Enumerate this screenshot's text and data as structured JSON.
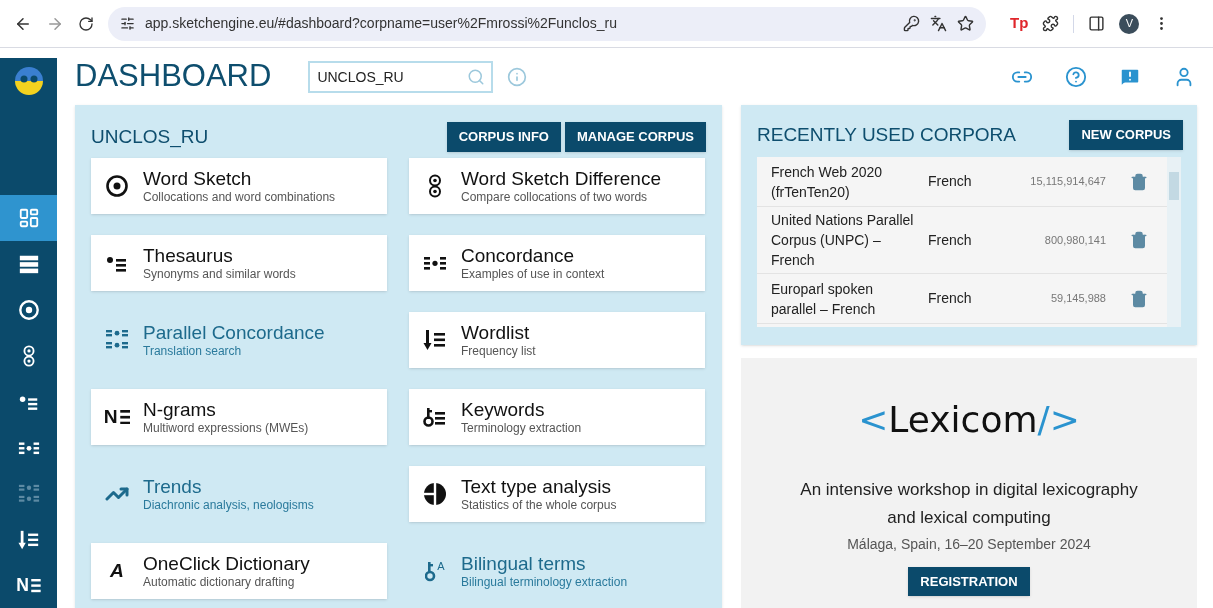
{
  "browser": {
    "url": "app.sketchengine.eu/#dashboard?corpname=user%2Fmrossi%2Funclos_ru",
    "extension_label": "Tp",
    "avatar": "V"
  },
  "sidebar": {
    "items": [
      {
        "kind": "dashboard",
        "selected": true,
        "disabled": false
      },
      {
        "kind": "corpora",
        "selected": false,
        "disabled": false
      },
      {
        "kind": "wordsketch",
        "selected": false,
        "disabled": false
      },
      {
        "kind": "wsdiff",
        "selected": false,
        "disabled": false
      },
      {
        "kind": "thesaurus",
        "selected": false,
        "disabled": false
      },
      {
        "kind": "concordance",
        "selected": false,
        "disabled": false
      },
      {
        "kind": "parconc",
        "selected": false,
        "disabled": true
      },
      {
        "kind": "wordlist",
        "selected": false,
        "disabled": false
      },
      {
        "kind": "ngrams",
        "icon_letter": "N",
        "selected": false,
        "disabled": false
      }
    ]
  },
  "header": {
    "title": "DASHBOARD",
    "search": {
      "value": "UNCLOS_RU"
    }
  },
  "corpus_panel": {
    "title": "UNCLOS_RU",
    "buttons": [
      "CORPUS INFO",
      "MANAGE CORPUS"
    ],
    "tools": [
      {
        "kind": "wordsketch",
        "title": "Word Sketch",
        "subtitle": "Collocations and word combinations",
        "available": true
      },
      {
        "kind": "wsdiff",
        "title": "Word Sketch Difference",
        "subtitle": "Compare collocations of two words",
        "available": true
      },
      {
        "kind": "thesaurus",
        "title": "Thesaurus",
        "subtitle": "Synonyms and similar words",
        "available": true
      },
      {
        "kind": "concordance",
        "title": "Concordance",
        "subtitle": "Examples of use in context",
        "available": true
      },
      {
        "kind": "parconc",
        "title": "Parallel Concordance",
        "subtitle": "Translation search",
        "available": false
      },
      {
        "kind": "wordlist",
        "title": "Wordlist",
        "subtitle": "Frequency list",
        "available": true
      },
      {
        "kind": "ngrams",
        "icon_letter": "N",
        "title": "N-grams",
        "subtitle": "Multiword expressions (MWEs)",
        "available": true
      },
      {
        "kind": "keywords",
        "title": "Keywords",
        "subtitle": "Terminology extraction",
        "available": true
      },
      {
        "kind": "trends",
        "title": "Trends",
        "subtitle": "Diachronic analysis, neologisms",
        "available": false
      },
      {
        "kind": "texttype",
        "title": "Text type analysis",
        "subtitle": "Statistics of the whole corpus",
        "available": true
      },
      {
        "kind": "oneclick",
        "icon_letter": "A",
        "title": "OneClick Dictionary",
        "subtitle": "Automatic dictionary drafting",
        "available": true
      },
      {
        "kind": "bilingual",
        "icon_letter": "A",
        "title": "Bilingual terms",
        "subtitle": "Bilingual terminology extraction",
        "available": false
      }
    ]
  },
  "recent_corpora": {
    "title": "RECENTLY USED CORPORA",
    "button": "NEW CORPUS",
    "rows": [
      {
        "name": "French Web 2020 (frTenTen20)",
        "language": "French",
        "size": "15,115,914,647"
      },
      {
        "name": "United Nations Parallel Corpus (UNPC) – French",
        "language": "French",
        "size": "800,980,141"
      },
      {
        "name": "Europarl spoken parallel – French",
        "language": "French",
        "size": "59,145,988"
      }
    ]
  },
  "banner": {
    "logo_left": "<",
    "logo_word": "Lexicom",
    "logo_right": "/>",
    "text": "An intensive workshop in digital lexicography and lexical computing",
    "details": "Málaga, Spain, 16–20 September 2024",
    "button": "REGISTRATION"
  }
}
